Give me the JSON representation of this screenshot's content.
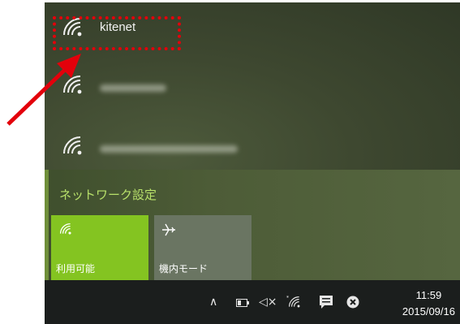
{
  "networks": [
    {
      "name": "kitenet",
      "highlighted": true
    },
    {
      "name": "",
      "blurred": true
    },
    {
      "name": "",
      "blurred": true
    }
  ],
  "settings": {
    "link_label": "ネットワーク設定"
  },
  "tiles": {
    "wifi_label": "利用可能",
    "airplane_label": "機内モード"
  },
  "taskbar": {
    "icons": [
      "chevron-up-icon",
      "battery-icon",
      "volume-muted-icon",
      "wifi-icon",
      "action-center-icon",
      "close-circle-icon"
    ],
    "time": "11:59",
    "date": "2015/09/16"
  },
  "colors": {
    "accent": "#84c421",
    "settings_link": "#b7e06a",
    "annotation": "#e3000b",
    "taskbar": "#1b1e1d"
  }
}
